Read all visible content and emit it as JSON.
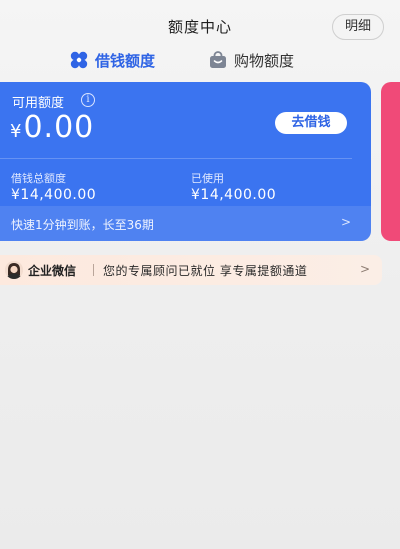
{
  "header": {
    "title": "额度中心",
    "detail_button": "明细"
  },
  "tabs": [
    {
      "label": "借钱额度",
      "icon": "clover-icon",
      "active": true
    },
    {
      "label": "购物额度",
      "icon": "shopping-bag-icon",
      "active": false
    }
  ],
  "loan_card": {
    "available_label": "可用额度",
    "info_icon": "i",
    "currency": "¥",
    "available_amount": "0.00",
    "borrow_button": "去借钱",
    "total_label": "借钱总额度",
    "total_value": "¥14,400.00",
    "used_label": "已使用",
    "used_value": "¥14,400.00",
    "promo_text": "快速1分钟到账，长至36期",
    "promo_chevron": ">"
  },
  "banner": {
    "brand": "企业微信",
    "message": "您的专属顾问已就位 享专属提额通道",
    "chevron": ">"
  },
  "colors": {
    "accent_blue": "#3b74f0",
    "tab_active": "#2f64e5",
    "peek_card": "#f04a78",
    "banner_bg": "#fde9de"
  }
}
